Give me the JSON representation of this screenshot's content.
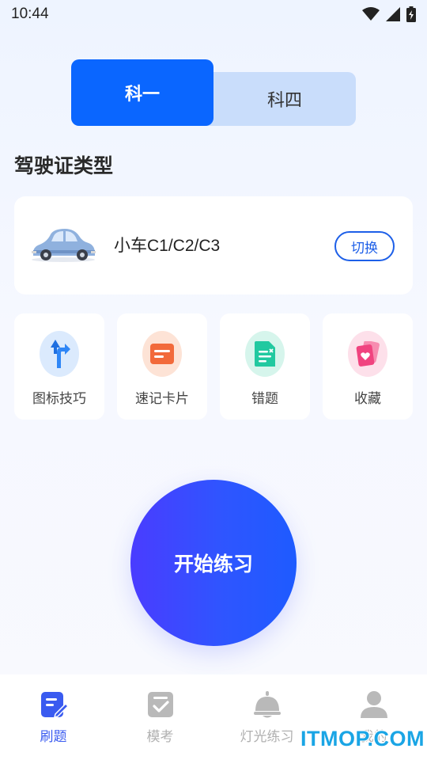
{
  "status_bar": {
    "time": "10:44",
    "icons": [
      "wifi-icon",
      "signal-icon",
      "battery-icon"
    ]
  },
  "subject_tabs": [
    {
      "label": "科一",
      "active": true
    },
    {
      "label": "科四",
      "active": false
    }
  ],
  "section_title": "驾驶证类型",
  "license_card": {
    "icon": "car-icon",
    "name": "小车C1/C2/C3",
    "switch_label": "切换"
  },
  "tools": [
    {
      "label": "图标技巧",
      "icon": "traffic-sign-icon",
      "color": "#2f86f6"
    },
    {
      "label": "速记卡片",
      "icon": "flash-card-icon",
      "color": "#f26a3b"
    },
    {
      "label": "错题",
      "icon": "wrong-question-icon",
      "color": "#21c9a0"
    },
    {
      "label": "收藏",
      "icon": "favorite-card-icon",
      "color": "#f0437f"
    }
  ],
  "start_button_label": "开始练习",
  "tab_bar": [
    {
      "label": "刷题",
      "icon": "practice-icon",
      "active": true
    },
    {
      "label": "模考",
      "icon": "mock-exam-icon",
      "active": false
    },
    {
      "label": "灯光练习",
      "icon": "light-practice-icon",
      "active": false
    },
    {
      "label": "我的",
      "icon": "profile-icon",
      "active": false
    }
  ],
  "watermark": "ITMOP.COM",
  "colors": {
    "primary": "#0a66ff",
    "tab_active": "#3a5bf0",
    "tab_inactive": "#b0b0b0"
  }
}
